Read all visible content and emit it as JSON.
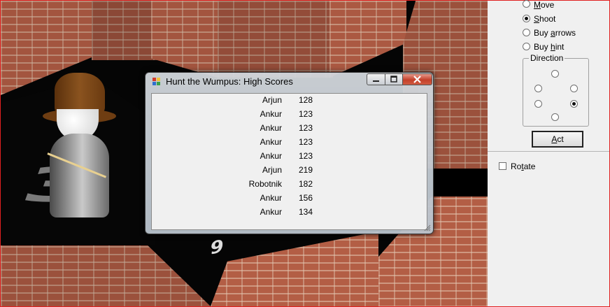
{
  "window": {
    "border_color": "#e02020"
  },
  "dialog": {
    "title": "Hunt the Wumpus: High Scores",
    "scores": [
      {
        "name": "Arjun",
        "score": "128"
      },
      {
        "name": "Ankur",
        "score": "123"
      },
      {
        "name": "Ankur",
        "score": "123"
      },
      {
        "name": "Ankur",
        "score": "123"
      },
      {
        "name": "Ankur",
        "score": "123"
      },
      {
        "name": "Arjun",
        "score": "219"
      },
      {
        "name": "Robotnik",
        "score": "182"
      },
      {
        "name": "Ankur",
        "score": "156"
      },
      {
        "name": "Ankur",
        "score": "134"
      }
    ]
  },
  "scene": {
    "room_number_large": "3",
    "room_number_small": "9"
  },
  "panel": {
    "actions": {
      "move": {
        "pre": "",
        "key": "M",
        "post": "ove",
        "selected": false
      },
      "shoot": {
        "pre": "",
        "key": "S",
        "post": "hoot",
        "selected": true
      },
      "buy_arrows": {
        "pre": "Buy ",
        "key": "a",
        "post": "rrows",
        "selected": false
      },
      "buy_hint": {
        "pre": "Buy ",
        "key": "h",
        "post": "int",
        "selected": false
      }
    },
    "direction_label": "Direction",
    "selected_direction": "lower-right",
    "act_button": {
      "pre": "",
      "key": "A",
      "post": "ct"
    },
    "rotate": {
      "pre": "Ro",
      "key": "t",
      "post": "ate",
      "checked": false
    }
  }
}
